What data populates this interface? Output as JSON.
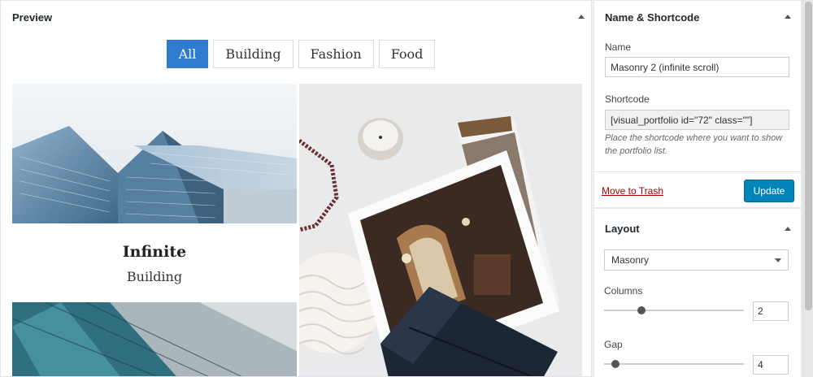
{
  "preview": {
    "title": "Preview",
    "filters": [
      "All",
      "Building",
      "Fashion",
      "Food"
    ],
    "active_filter": "All",
    "card": {
      "title": "Infinite",
      "category": "Building"
    }
  },
  "shortcode_panel": {
    "title": "Name & Shortcode",
    "name_label": "Name",
    "name_value": "Masonry 2 (infinite scroll)",
    "shortcode_label": "Shortcode",
    "shortcode_value": "[visual_portfolio id=\"72\" class=\"\"]",
    "hint": "Place the shortcode where you want to show the portfolio list.",
    "trash_label": "Move to Trash",
    "update_label": "Update"
  },
  "layout_panel": {
    "title": "Layout",
    "layout_value": "Masonry",
    "columns_label": "Columns",
    "columns_value": "2",
    "gap_label": "Gap",
    "gap_value": "4"
  },
  "colors": {
    "accent": "#2e7ccf",
    "update_button": "#0085ba",
    "trash_link": "#a00000"
  }
}
